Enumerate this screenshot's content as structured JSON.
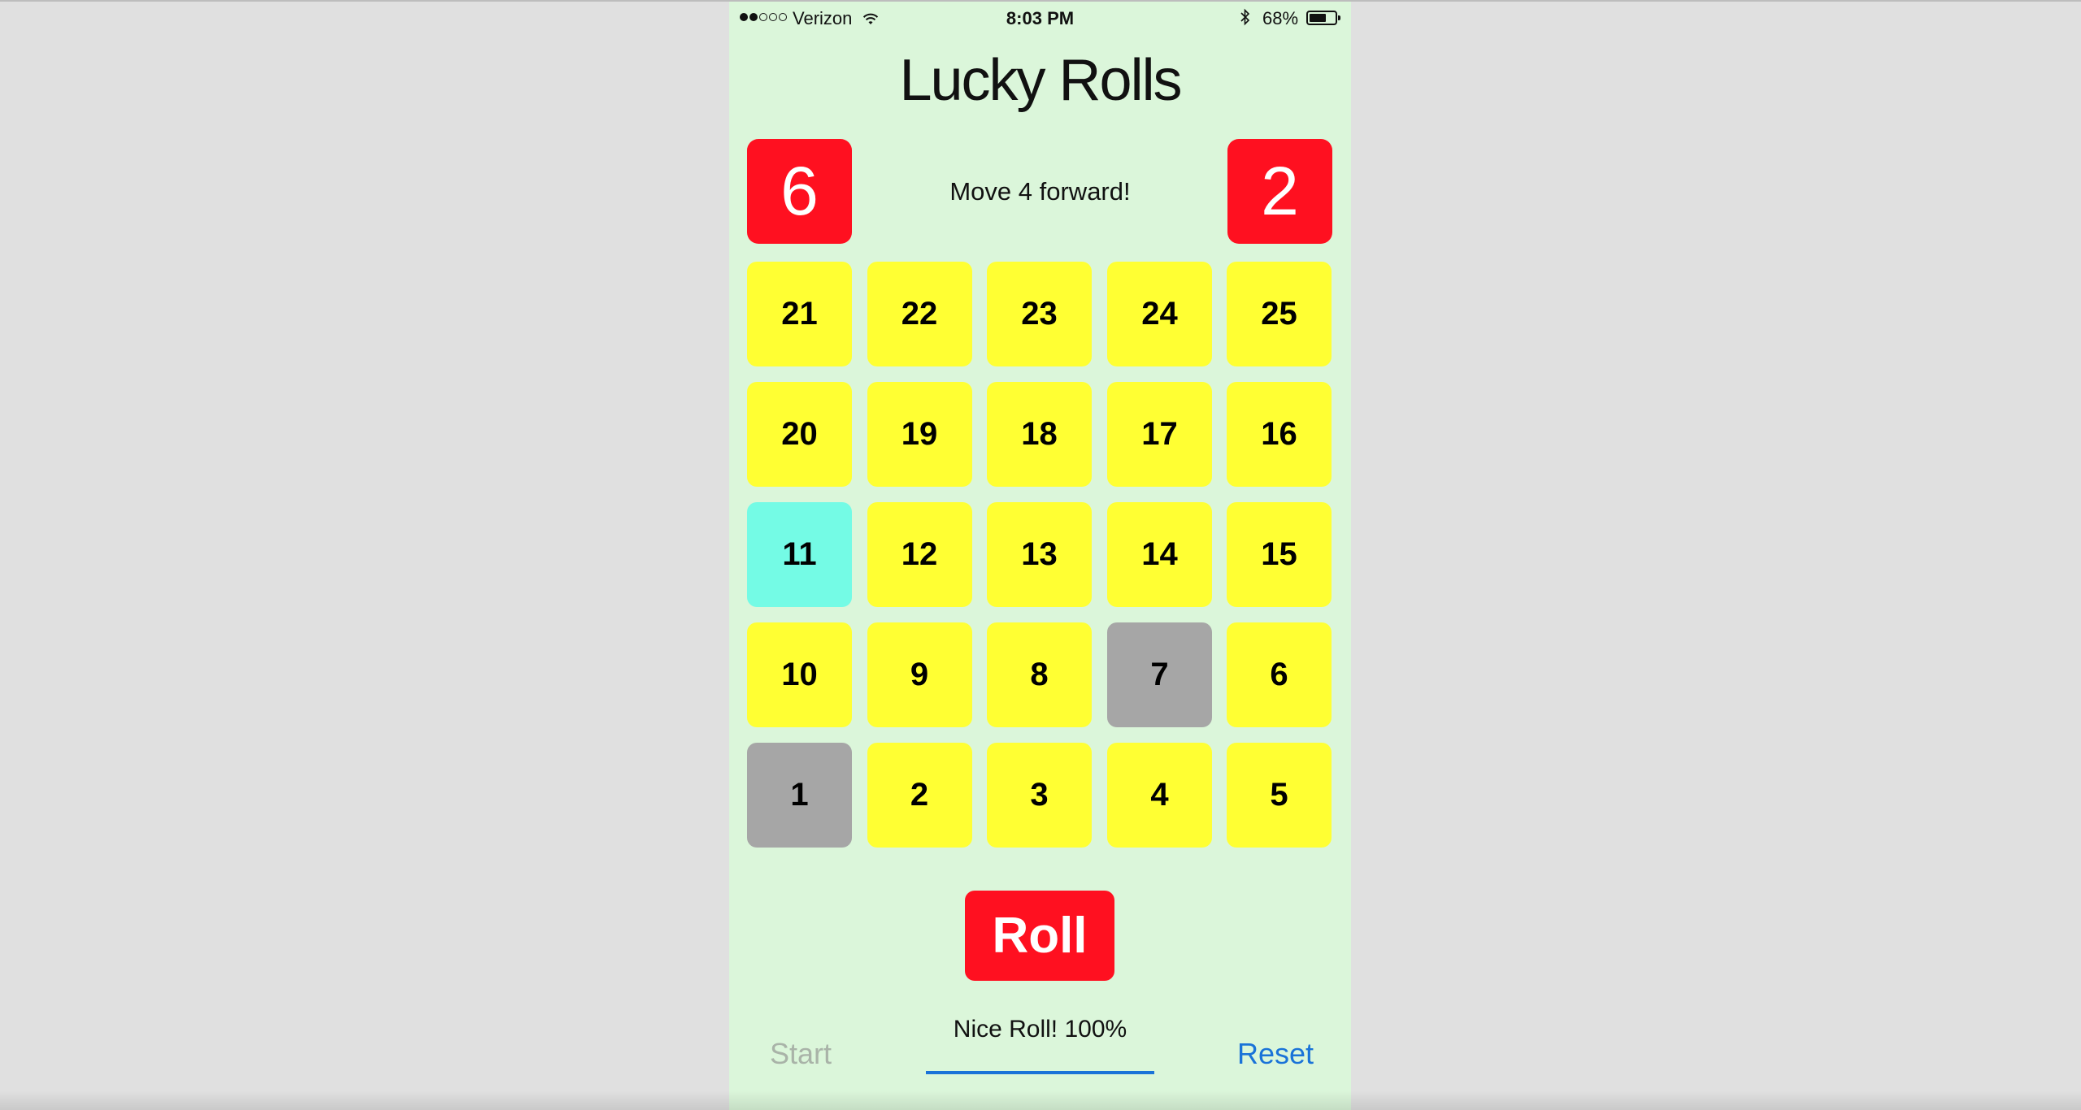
{
  "status_bar": {
    "carrier": "Verizon",
    "time": "8:03 PM",
    "battery": "68%",
    "battery_level": 0.68,
    "signal_bars_filled": 2,
    "signal_bars_total": 5
  },
  "app": {
    "title": "Lucky Rolls",
    "die_left": "6",
    "die_right": "2",
    "message": "Move 4 forward!",
    "roll_label": "Roll",
    "status_text": "Nice Roll! 100%",
    "progress": 1.0,
    "start_label": "Start",
    "reset_label": "Reset"
  },
  "board": {
    "rows": [
      [
        {
          "n": "21",
          "state": "normal"
        },
        {
          "n": "22",
          "state": "normal"
        },
        {
          "n": "23",
          "state": "normal"
        },
        {
          "n": "24",
          "state": "normal"
        },
        {
          "n": "25",
          "state": "normal"
        }
      ],
      [
        {
          "n": "20",
          "state": "normal"
        },
        {
          "n": "19",
          "state": "normal"
        },
        {
          "n": "18",
          "state": "normal"
        },
        {
          "n": "17",
          "state": "normal"
        },
        {
          "n": "16",
          "state": "normal"
        }
      ],
      [
        {
          "n": "11",
          "state": "current"
        },
        {
          "n": "12",
          "state": "normal"
        },
        {
          "n": "13",
          "state": "normal"
        },
        {
          "n": "14",
          "state": "normal"
        },
        {
          "n": "15",
          "state": "normal"
        }
      ],
      [
        {
          "n": "10",
          "state": "normal"
        },
        {
          "n": "9",
          "state": "normal"
        },
        {
          "n": "8",
          "state": "normal"
        },
        {
          "n": "7",
          "state": "visited"
        },
        {
          "n": "6",
          "state": "normal"
        }
      ],
      [
        {
          "n": "1",
          "state": "visited"
        },
        {
          "n": "2",
          "state": "normal"
        },
        {
          "n": "3",
          "state": "normal"
        },
        {
          "n": "4",
          "state": "normal"
        },
        {
          "n": "5",
          "state": "normal"
        }
      ]
    ]
  },
  "colors": {
    "background": "#dbf6da",
    "accent_red": "#ff1020",
    "tile_yellow": "#ffff33",
    "tile_visited": "#a6a6a6",
    "tile_current": "#74fbe5",
    "link_blue": "#1a73d8"
  }
}
